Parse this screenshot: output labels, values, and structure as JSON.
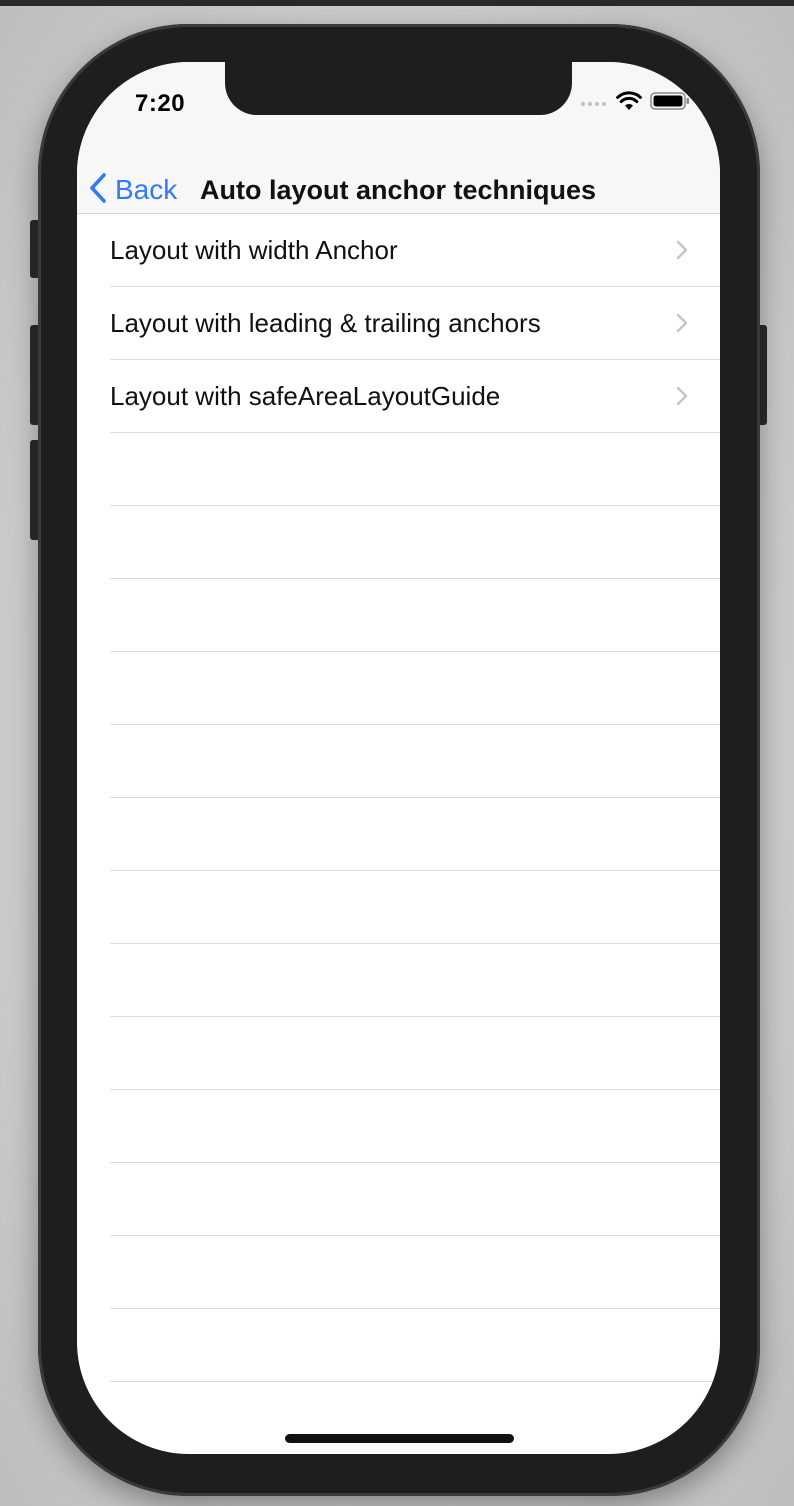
{
  "status_bar": {
    "time": "7:20",
    "icons": [
      "cellular-dots-icon",
      "wifi-icon",
      "battery-icon"
    ]
  },
  "nav_bar": {
    "back_label": "Back",
    "title": "Auto layout anchor techniques"
  },
  "table": {
    "rows": [
      {
        "label": "Layout with width Anchor"
      },
      {
        "label": "Layout with leading & trailing anchors"
      },
      {
        "label": "Layout with safeAreaLayoutGuide"
      }
    ]
  },
  "colors": {
    "accent": "#2f7cf6",
    "separator": "#dcdcde",
    "bar_background": "#f7f7f7"
  }
}
